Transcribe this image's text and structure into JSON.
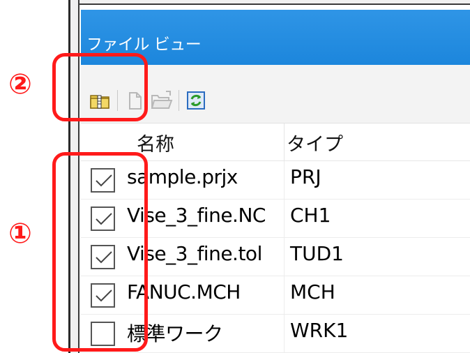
{
  "panel": {
    "title": "ファイル ビュー"
  },
  "toolbar": {
    "buttons": [
      {
        "icon": "zip-folder-icon",
        "enabled": true
      },
      {
        "icon": "document-icon",
        "enabled": false
      },
      {
        "icon": "open-folder-icon",
        "enabled": false
      },
      {
        "icon": "refresh-icon",
        "enabled": true
      }
    ]
  },
  "table": {
    "columns": [
      "名称",
      "タイプ"
    ],
    "rows": [
      {
        "name": "sample.prjx",
        "type": "PRJ",
        "checked": true
      },
      {
        "name": "Vise_3_fine.NC",
        "type": "CH1",
        "checked": true
      },
      {
        "name": "Vise_3_fine.tol",
        "type": "TUD1",
        "checked": true
      },
      {
        "name": "FANUC.MCH",
        "type": "MCH",
        "checked": true
      },
      {
        "name": "標準ワーク",
        "type": "WRK1",
        "checked": false
      }
    ]
  },
  "annotations": {
    "marker_1": "①",
    "marker_2": "②",
    "color": "#ff1a1a"
  }
}
